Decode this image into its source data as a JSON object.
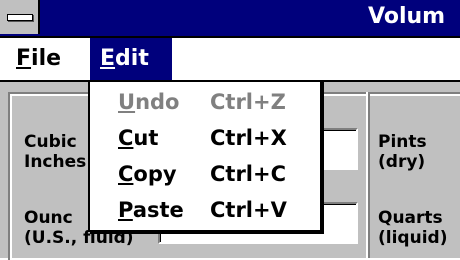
{
  "window": {
    "title_partial": "Volum"
  },
  "menubar": {
    "file": {
      "accel": "F",
      "rest": "ile"
    },
    "edit": {
      "accel": "E",
      "rest": "dit"
    }
  },
  "edit_menu": {
    "items": [
      {
        "accel": "U",
        "rest": "ndo",
        "shortcut": "Ctrl+Z",
        "enabled": false
      },
      {
        "accel": "C",
        "rest": "ut",
        "shortcut": "Ctrl+X",
        "enabled": true
      },
      {
        "accel": "C",
        "rest": "opy",
        "shortcut": "Ctrl+C",
        "enabled": true
      },
      {
        "accel": "P",
        "rest": "aste",
        "shortcut": "Ctrl+V",
        "enabled": true
      }
    ]
  },
  "fields": {
    "cubic_inches": {
      "label_line1": "Cubic",
      "label_line2": "Inches"
    },
    "ounces": {
      "label_line1": "Ounc",
      "label_line2": "(U.S., fluid)"
    },
    "pints": {
      "label_line1": "Pints",
      "label_line2": "(dry)"
    },
    "quarts": {
      "label_line1": "Quarts",
      "label_line2": "(liquid)"
    }
  },
  "colors": {
    "titlebar": "#00007c",
    "face": "#c0c0c0",
    "highlight": "#00007c",
    "disabled_text": "#808080"
  }
}
